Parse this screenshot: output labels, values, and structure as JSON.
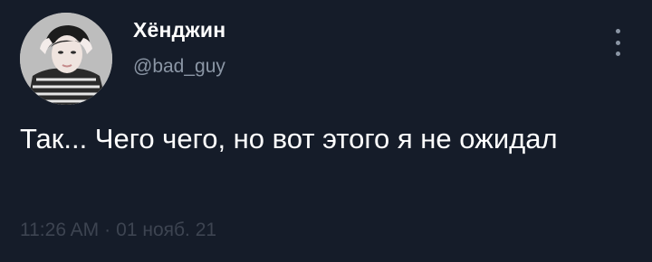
{
  "author": {
    "display_name": "Хёнджин",
    "handle": "@bad_guy",
    "avatar_icon": "profile-photo"
  },
  "tweet": {
    "text": "Так... Чего чего, но вот этого я не ожидал",
    "time": "11:26 AM",
    "separator": "·",
    "date": "01 нояб. 21"
  },
  "menu": {
    "icon": "more-vertical-icon"
  },
  "colors": {
    "background": "#151c29",
    "primary_text": "#ffffff",
    "secondary_text": "#8b96a5",
    "meta_text": "#3d4451"
  }
}
